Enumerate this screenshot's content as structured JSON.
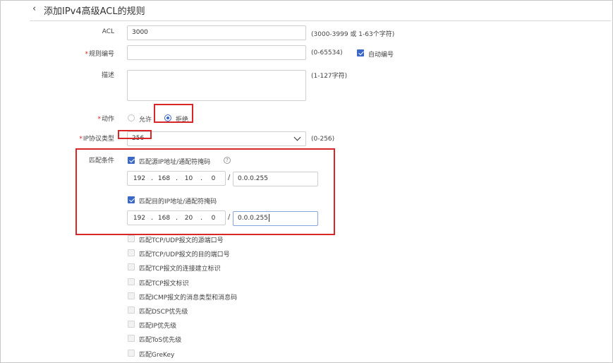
{
  "page": {
    "title": "添加IPv4高级ACL的规则"
  },
  "form": {
    "acl": {
      "label": "ACL",
      "value": "3000",
      "hint": "(3000-3999 或 1-63个字符)"
    },
    "rule_id": {
      "label": "规则编号",
      "value": "",
      "hint": "(0-65534)",
      "auto_label": "自动编号",
      "auto_checked": true
    },
    "description": {
      "label": "描述",
      "value": "",
      "hint": "(1-127字符)"
    },
    "action": {
      "label": "动作",
      "options": [
        "允许",
        "拒绝"
      ],
      "selected": "拒绝"
    },
    "ip_protocol": {
      "label": "IP协议类型",
      "value": "256",
      "hint": "(0-256)"
    },
    "match": {
      "label": "匹配条件",
      "src": {
        "label": "匹配源IP地址/通配符掩码",
        "checked": true,
        "octets": [
          "192",
          "168",
          "10",
          "0"
        ],
        "wildcard": "0.0.0.255"
      },
      "dst": {
        "label": "匹配目的IP地址/通配符掩码",
        "checked": true,
        "octets": [
          "192",
          "168",
          "20",
          "0"
        ],
        "wildcard": "0.0.0.255"
      },
      "slash": "/",
      "dot": ".",
      "help_glyph": "?",
      "others": [
        "匹配TCP/UDP报文的源端口号",
        "匹配TCP/UDP报文的目的端口号",
        "匹配TCP报文的连接建立标识",
        "匹配TCP报文标识",
        "匹配ICMP报文的消息类型和消息码",
        "匹配DSCP优先级",
        "匹配IP优先级",
        "匹配ToS优先级",
        "匹配GreKey"
      ]
    }
  },
  "colors": {
    "accent": "#3b67c9",
    "highlight": "#d9262b",
    "required": "#e02020"
  },
  "icons": {
    "back": "chevron-left-icon",
    "dropdown": "chevron-down-icon",
    "help": "question-circle-icon"
  }
}
